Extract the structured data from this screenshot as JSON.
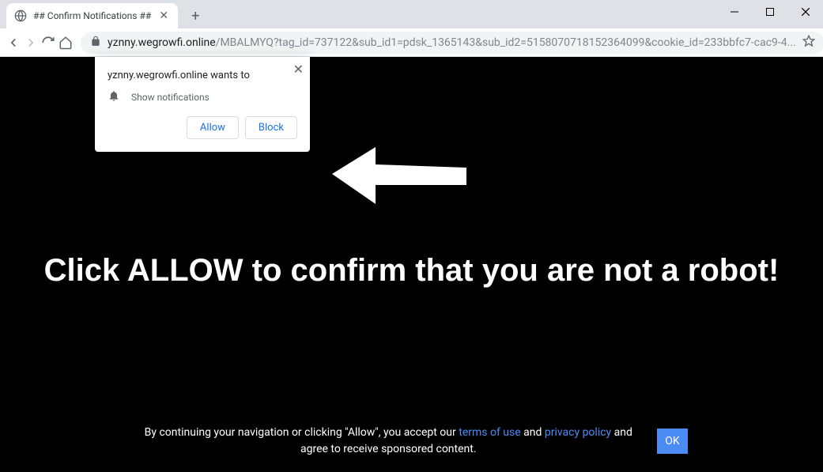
{
  "tab": {
    "title": "## Confirm Notifications ##"
  },
  "url": {
    "domain": "yznny.wegrowfi.online",
    "path": "/MBALMYQ?tag_id=737122&sub_id1=pdsk_1365143&sub_id2=5158070718152364099&cookie_id=233bbfc7-cac9-4..."
  },
  "perm": {
    "origin": "yznny.wegrowfi.online wants to",
    "request": "Show notifications",
    "allow": "Allow",
    "block": "Block"
  },
  "page": {
    "headline": "Click ALLOW to confirm that you are not a robot!",
    "cookie_pre": "By continuing your navigation or clicking \"Allow\", you accept our ",
    "terms": "terms of use",
    "and": " and ",
    "privacy": "privacy policy",
    "cookie_post": " and agree to receive sponsored content.",
    "ok": "OK"
  }
}
